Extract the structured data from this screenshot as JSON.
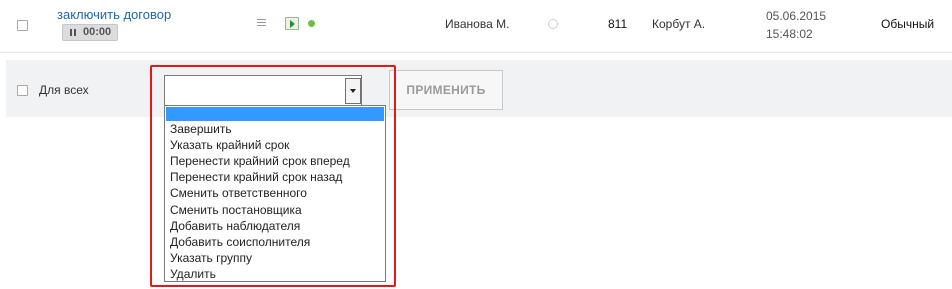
{
  "task_row": {
    "title": "заключить договор",
    "timer": "00:00",
    "responsible": "Иванова М.",
    "number": "811",
    "creator": "Корбут А.",
    "date": "05.06.2015",
    "time": "15:48:02",
    "priority": "Обычный"
  },
  "group_action": {
    "checkbox_label": "Для всех",
    "select_value": "",
    "apply_label": "ПРИМЕНИТЬ",
    "options": [
      "Завершить",
      "Указать крайний срок",
      "Перенести крайний срок вперед",
      "Перенести крайний срок назад",
      "Сменить ответственного",
      "Сменить постановщика",
      "Добавить наблюдателя",
      "Добавить соисполнителя",
      "Указать группу",
      "Удалить"
    ]
  },
  "colors": {
    "link": "#2067b0",
    "highlight": "#3399ff",
    "annotation": "#e01a1a",
    "status_dot": "#6dbf3f"
  },
  "icons": [
    "pause-icon",
    "menu-icon",
    "play-icon",
    "status-dot-icon",
    "circle-icon",
    "dropdown-arrow-icon"
  ]
}
